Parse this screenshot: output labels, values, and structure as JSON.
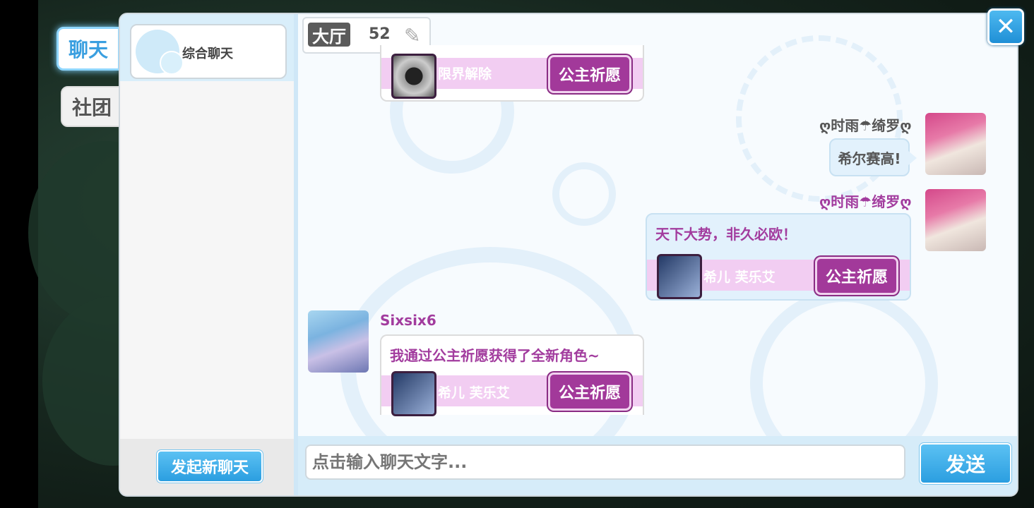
{
  "sidebar": {
    "tabs": [
      {
        "label": "聊天",
        "active": true
      },
      {
        "label": "社团",
        "active": false
      }
    ]
  },
  "chat_list": {
    "items": [
      {
        "label": "综合聊天"
      }
    ],
    "new_chat_button": "发起新聊天"
  },
  "channel": {
    "name": "大厅",
    "count": "52",
    "edit_icon": "edit-pencil-icon"
  },
  "close_icon": "close-icon",
  "messages": [
    {
      "type": "wish-card-partial",
      "card_name": "限界解除",
      "button": "公主祈愿"
    },
    {
      "type": "self-text",
      "sender": "ღ时雨☂绮罗ღ",
      "text": "希尔赛高!"
    },
    {
      "type": "self-card",
      "sender": "ღ时雨☂绮罗ღ",
      "text": "天下大势，非久必欧！",
      "card_name": "希儿 芙乐艾",
      "button": "公主祈愿"
    },
    {
      "type": "other-card",
      "sender": "Sixsix6",
      "text": "我通过公主祈愿获得了全新角色~",
      "card_name": "希儿 芙乐艾",
      "button": "公主祈愿"
    }
  ],
  "input": {
    "placeholder": "点击输入聊天文字...",
    "value": ""
  },
  "send_button": "发送",
  "colors": {
    "accent_blue": "#2b9ee0",
    "wish_purple": "#a2399a",
    "message_purple": "#a23c9e"
  }
}
